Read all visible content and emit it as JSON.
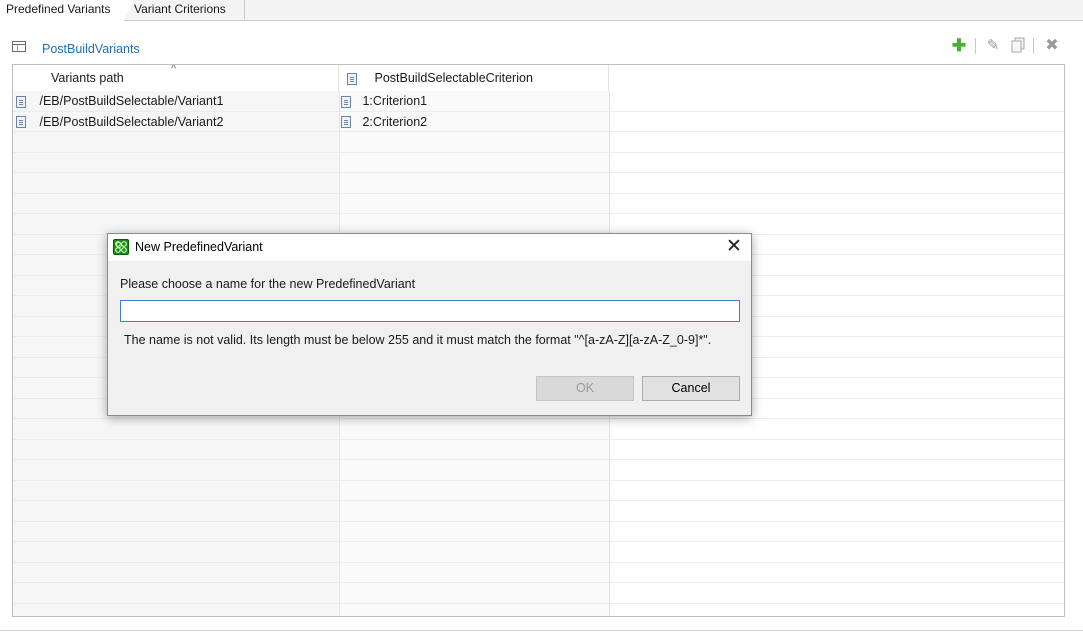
{
  "tabs": [
    {
      "label": "Predefined Variants",
      "active": true
    },
    {
      "label": "Variant Criterions",
      "active": false
    }
  ],
  "section": {
    "title": "PostBuildVariants",
    "icon": "table-icon"
  },
  "toolbar": {
    "add_icon": "plus-icon",
    "edit_icon": "pencil-icon",
    "copy_icon": "copy-icon",
    "delete_icon": "delete-icon",
    "add_color": "#4caf35"
  },
  "table": {
    "columns": [
      "Variants path",
      "PostBuildSelectableCriterion"
    ],
    "sort_indicator": "^",
    "rows": [
      {
        "path": "/EB/PostBuildSelectable/Variant1",
        "criterion": "1:Criterion1"
      },
      {
        "path": "/EB/PostBuildSelectable/Variant2",
        "criterion": "2:Criterion2"
      }
    ]
  },
  "dialog": {
    "title": "New PredefinedVariant",
    "prompt": "Please choose a name for the new PredefinedVariant",
    "input_value": "",
    "error": "The name is not valid. Its length must be below 255 and it must match the format \"^[a-zA-Z][a-zA-Z_0-9]*\".",
    "ok_label": "OK",
    "cancel_label": "Cancel",
    "ok_enabled": false,
    "close_icon": "close-icon"
  },
  "colors": {
    "link_blue": "#1f6fb5",
    "focus_border": "#3c7fd4"
  }
}
